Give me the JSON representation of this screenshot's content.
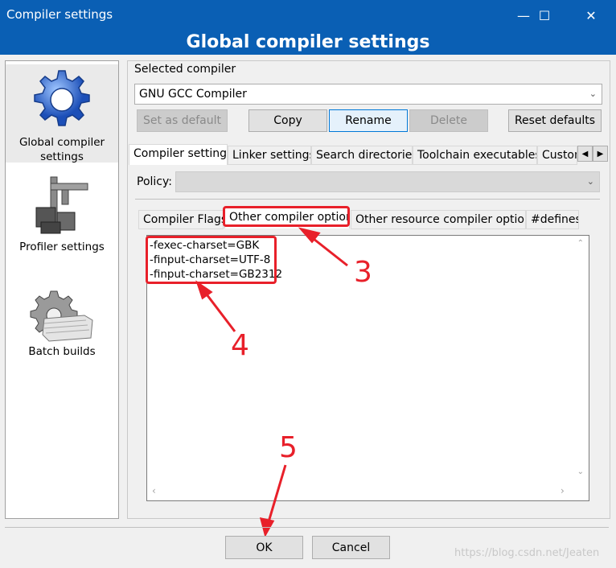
{
  "window": {
    "title": "Compiler settings",
    "minimize": "—",
    "maximize": "☐",
    "close": "✕"
  },
  "header": {
    "title": "Global compiler settings"
  },
  "sidebar": {
    "items": [
      {
        "label_line1": "Global compiler",
        "label_line2": "settings",
        "icon": "gear-icon"
      },
      {
        "label": "Profiler settings",
        "icon": "caliper-icon"
      },
      {
        "label": "Batch builds",
        "icon": "batch-gear-icon"
      }
    ]
  },
  "compiler": {
    "section_label": "Selected compiler",
    "selected": "GNU GCC Compiler",
    "buttons": {
      "set_default": "Set as default",
      "copy": "Copy",
      "rename": "Rename",
      "delete": "Delete",
      "reset": "Reset defaults"
    }
  },
  "main_tabs": [
    "Compiler settings",
    "Linker settings",
    "Search directories",
    "Toolchain executables",
    "Custom"
  ],
  "main_tab_scroll": {
    "left": "◀",
    "right": "▶"
  },
  "policy": {
    "label": "Policy:",
    "value": ""
  },
  "sub_tabs": [
    "Compiler Flags",
    "Other compiler options",
    "Other resource compiler options",
    "#defines"
  ],
  "options_text": [
    "-fexec-charset=GBK",
    "-finput-charset=UTF-8",
    "-finput-charset=GB2312"
  ],
  "annotations": [
    "3",
    "4",
    "5"
  ],
  "footer": {
    "ok": "OK",
    "cancel": "Cancel"
  },
  "watermark": "https://blog.csdn.net/Jeaten",
  "colors": {
    "titlebar": "#0a5fb4",
    "annotation_red": "#e8202a",
    "focus_blue": "#0078d7"
  }
}
